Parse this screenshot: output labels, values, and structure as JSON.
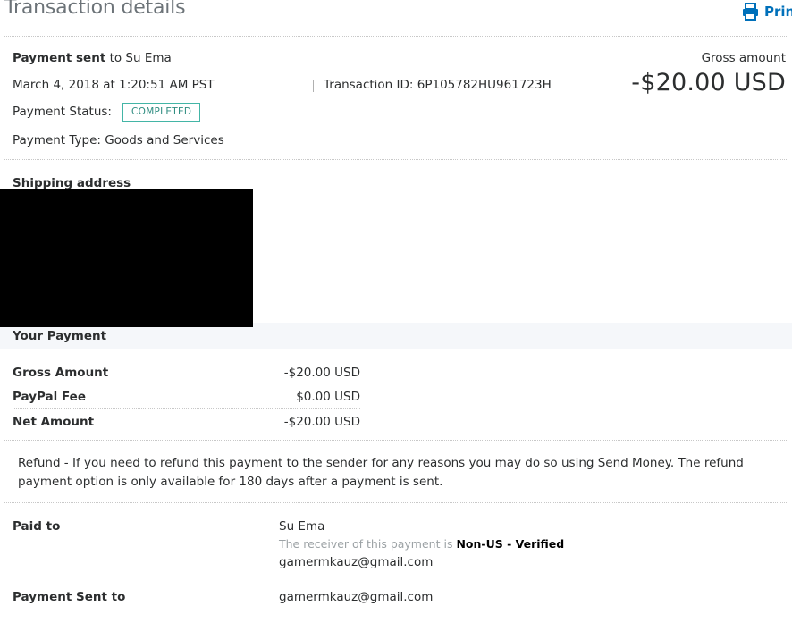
{
  "header": {
    "title": "Transaction details",
    "print_label": "Print"
  },
  "summary": {
    "sent_label": "Payment sent",
    "sent_to": " to Su Ema",
    "datetime": "March 4, 2018 at 1:20:51 AM PST",
    "transaction_id_label": "Transaction ID:",
    "transaction_id": "6P105782HU961723H",
    "status_label": "Payment Status:",
    "status_value": "COMPLETED",
    "type_text": "Payment Type: Goods and Services",
    "gross_label": "Gross amount",
    "gross_value": "-$20.00 USD"
  },
  "shipping": {
    "label": "Shipping address"
  },
  "your_payment": {
    "section_label": "Your Payment",
    "rows": [
      {
        "label": "Gross Amount",
        "value": "-$20.00 USD"
      },
      {
        "label": "PayPal Fee",
        "value": "$0.00 USD"
      },
      {
        "label": "Net Amount",
        "value": "-$20.00 USD"
      }
    ]
  },
  "refund": {
    "text": "Refund - If you need to refund this payment to the sender for any reasons you may do so using Send Money. The refund payment option is only available for 180 days after a payment is sent."
  },
  "paid_to": {
    "label": "Paid to",
    "name": "Su Ema",
    "receiver_note": "The receiver of this payment is ",
    "receiver_status": "Non-US - Verified",
    "email": "gamermkauz@gmail.com"
  },
  "payment_sent_to": {
    "label": "Payment Sent to",
    "email": "gamermkauz@gmail.com"
  },
  "colors": {
    "link": "#0070ba",
    "status_border": "#43b5a6",
    "band": "#f5f7fa"
  }
}
